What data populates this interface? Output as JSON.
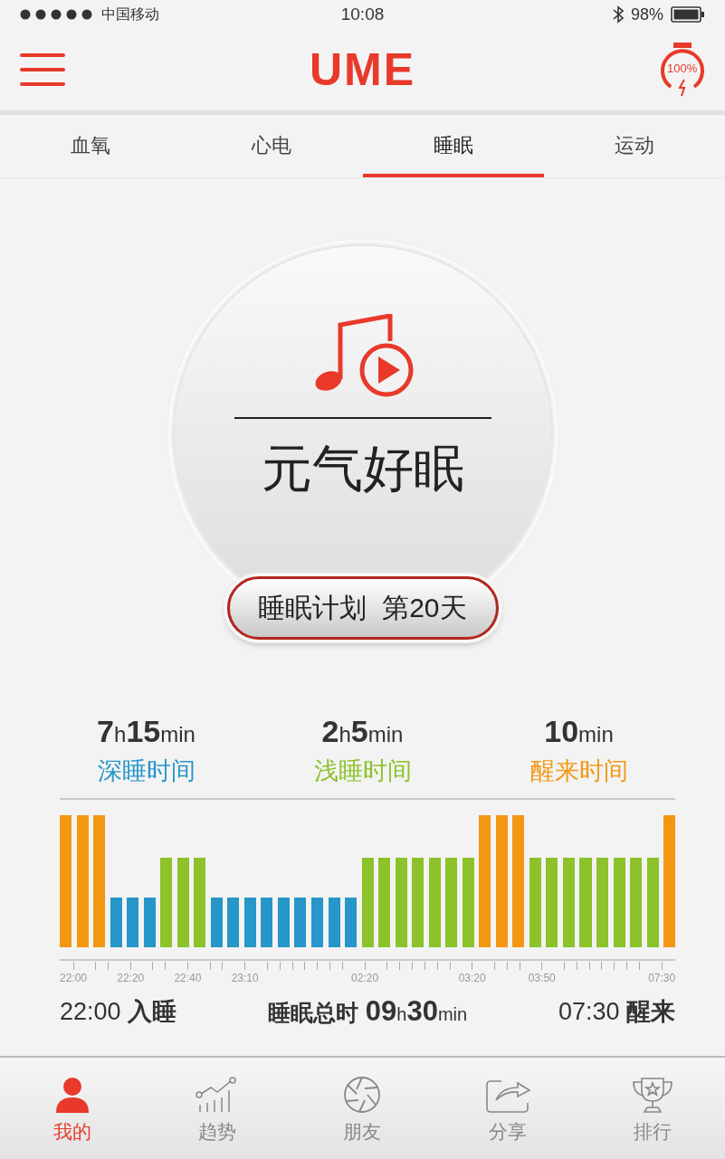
{
  "status_bar": {
    "carrier": "中国移动",
    "time": "10:08",
    "battery": "98%"
  },
  "header": {
    "logo": "UME",
    "charge": "100%"
  },
  "tabs": [
    {
      "label": "血氧",
      "selected": false
    },
    {
      "label": "心电",
      "selected": false
    },
    {
      "label": "睡眠",
      "selected": true
    },
    {
      "label": "运动",
      "selected": false
    }
  ],
  "player": {
    "title": "元气好眠",
    "plan_button": "睡眠计划  第20天"
  },
  "stats": [
    {
      "value": "**7**h**15**min",
      "label": "深睡时间",
      "color": "#2796c9"
    },
    {
      "value": "**2**h**5**min",
      "label": "浅睡时间",
      "color": "#8cc22a"
    },
    {
      "value": "**10**min",
      "label": "醒来时间",
      "color": "#f39713"
    }
  ],
  "chart": {
    "bars": [
      {
        "kind": "awake",
        "tick": "22:00"
      },
      {
        "kind": "awake"
      },
      {
        "kind": "awake"
      },
      {
        "kind": "deep",
        "tick": "22:20"
      },
      {
        "kind": "deep"
      },
      {
        "kind": "deep"
      },
      {
        "kind": "light",
        "tick": "22:40"
      },
      {
        "kind": "light"
      },
      {
        "kind": "light"
      },
      {
        "kind": "deep",
        "tick": "23:10"
      },
      {
        "kind": "deep"
      },
      {
        "kind": "deep"
      },
      {
        "kind": "deep"
      },
      {
        "kind": "deep"
      },
      {
        "kind": "deep"
      },
      {
        "kind": "deep"
      },
      {
        "kind": "deep"
      },
      {
        "kind": "deep",
        "tick": "02:20"
      },
      {
        "kind": "light"
      },
      {
        "kind": "light"
      },
      {
        "kind": "light"
      },
      {
        "kind": "light"
      },
      {
        "kind": "light"
      },
      {
        "kind": "light"
      },
      {
        "kind": "light",
        "tick": "03:20"
      },
      {
        "kind": "awake"
      },
      {
        "kind": "awake"
      },
      {
        "kind": "awake"
      },
      {
        "kind": "light",
        "tick": "03:50"
      },
      {
        "kind": "light"
      },
      {
        "kind": "light"
      },
      {
        "kind": "light"
      },
      {
        "kind": "light"
      },
      {
        "kind": "light"
      },
      {
        "kind": "light"
      },
      {
        "kind": "light"
      },
      {
        "kind": "awake",
        "tick": "07:30"
      }
    ]
  },
  "summary": {
    "sleep_start": "22:00 **入睡**",
    "total_label": "睡眠总时",
    "total_value": "**09**h**30**min",
    "wake": "07:30 **醒来**"
  },
  "nav": [
    {
      "kind": "me",
      "label": "我的",
      "selected": true
    },
    {
      "kind": "trend",
      "label": "趋势",
      "selected": false
    },
    {
      "kind": "friends",
      "label": "朋友",
      "selected": false
    },
    {
      "kind": "share",
      "label": "分享",
      "selected": false
    },
    {
      "kind": "rank",
      "label": "排行",
      "selected": false
    }
  ]
}
